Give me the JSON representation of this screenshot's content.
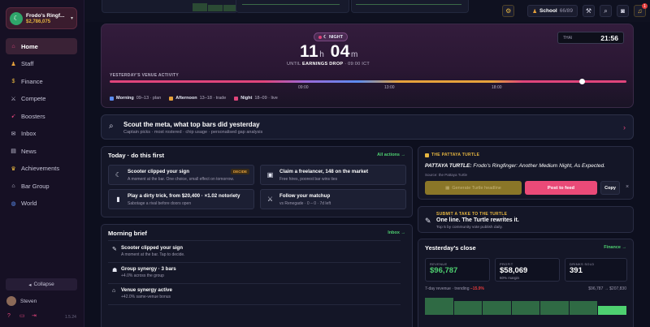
{
  "brand": {
    "name": "Frodo's Ringf...",
    "money": "$2,786,075",
    "avatar_glyph": "☾"
  },
  "nav": [
    {
      "label": "Home",
      "icon": "home-icon",
      "glyph": "⌂",
      "color": "#e0457b",
      "active": true
    },
    {
      "label": "Staff",
      "icon": "staff-icon",
      "glyph": "♟",
      "color": "#e6a23c"
    },
    {
      "label": "Finance",
      "icon": "finance-icon",
      "glyph": "$",
      "color": "#e6b640"
    },
    {
      "label": "Compete",
      "icon": "swords-icon",
      "glyph": "⚔",
      "color": "#c5c3d6"
    },
    {
      "label": "Boosters",
      "icon": "rocket-icon",
      "glyph": "➹",
      "color": "#e0457b"
    },
    {
      "label": "Inbox",
      "icon": "inbox-icon",
      "glyph": "✉",
      "color": "#c5c3d6"
    },
    {
      "label": "News",
      "icon": "news-icon",
      "glyph": "▤",
      "color": "#c5c3d6"
    },
    {
      "label": "Achievements",
      "icon": "trophy-icon",
      "glyph": "♛",
      "color": "#e6b640"
    },
    {
      "label": "Bar Group",
      "icon": "group-icon",
      "glyph": "⌂",
      "color": "#c5c3d6"
    },
    {
      "label": "World",
      "icon": "globe-icon",
      "glyph": "◍",
      "color": "#5b8cf0"
    }
  ],
  "collapse_label": "Collapse",
  "user_name": "Steven",
  "version": "1.5.24",
  "topbar": {
    "school_label": "School",
    "school_count": "66/89",
    "notif_count": "1"
  },
  "hero": {
    "pill": "NIGHT",
    "hours": "11",
    "hours_unit": "h",
    "minutes": "04",
    "minutes_unit": "m",
    "until_prefix": "UNTIL",
    "until_event": "EARNINGS DROP",
    "until_time": "· 09:00 ICT",
    "clock_tz": "THAI",
    "clock_time": "21:56",
    "activity_label": "YESTERDAY'S VENUE ACTIVITY",
    "ticks": [
      "09:00",
      "13:00",
      "18:00"
    ],
    "current_position": 0.915,
    "legend": [
      {
        "name": "Morning",
        "range": "09–13 · plan",
        "color": "#5b8cf0"
      },
      {
        "name": "Afternoon",
        "range": "13–18 · trade",
        "color": "#e6a23c"
      },
      {
        "name": "Night",
        "range": "18–09 · live",
        "color": "#e0457b"
      }
    ]
  },
  "scout": {
    "title": "Scout the meta, what top bars did yesterday",
    "subtitle": "Captain picks · most rostered · chip usage · personalised gap analysis"
  },
  "today": {
    "title": "Today · do this first",
    "link": "All actions →",
    "cards": [
      {
        "title": "Scooter clipped your sign",
        "desc": "A moment at the bar. One choice, small effect on tomorrow.",
        "icon": "moon-icon",
        "glyph": "☾",
        "tag": "DECIDE"
      },
      {
        "title": "Claim a freelancer, 148 on the market",
        "desc": "Free hires, poorest bar wins ties",
        "icon": "card-icon",
        "glyph": "▣"
      },
      {
        "title": "Play a dirty trick, from $20,400 · ×1.02 notoriety",
        "desc": "Sabotage a rival before doors open",
        "icon": "trick-icon",
        "glyph": "▮"
      },
      {
        "title": "Follow your matchup",
        "desc": "vs Renegade · 0 – 0 · 7d left",
        "icon": "swords-icon",
        "glyph": "⚔"
      }
    ]
  },
  "brief": {
    "title": "Morning brief",
    "link": "Inbox →",
    "items": [
      {
        "title": "Scooter clipped your sign",
        "desc": "A moment at the bar. Tap to decide.",
        "icon": "scooter-icon",
        "glyph": "✎"
      },
      {
        "title": "Group synergy · 3 bars",
        "desc": "+4.0% across the group",
        "icon": "group-icon",
        "glyph": "☗"
      },
      {
        "title": "Venue synergy active",
        "desc": "+42.0% same-venue bonus",
        "icon": "venue-icon",
        "glyph": "⌂"
      }
    ]
  },
  "turtle": {
    "tag": "THE PATTAYA TURTLE",
    "headline_bold": "PATTAYA TURTLE:",
    "headline_rest": "Frodo's Ringfinger: Another Medium Night, As Expected.",
    "source": "Source: the Pattaya Turtle",
    "generate_label": "Generate Turtle headline",
    "post_label": "Post to feed",
    "copy_label": "Copy",
    "close_glyph": "×"
  },
  "submit": {
    "tag": "SUBMIT A TAKE TO THE TURTLE",
    "title": "One line. The Turtle rewrites it.",
    "subtitle": "Top 5 by community vote publish daily."
  },
  "close": {
    "title": "Yesterday's close",
    "link": "Finance →",
    "stats": [
      {
        "label": "REVENUE",
        "value": "$96,787",
        "sub": "",
        "color": "#4ed070"
      },
      {
        "label": "PROFIT",
        "value": "$58,069",
        "sub": "60% margin",
        "color": "#ffffff"
      },
      {
        "label": "DRINKS SOLD",
        "value": "391",
        "sub": "",
        "color": "#ffffff"
      }
    ],
    "trend_label": "7-day revenue · trending",
    "trend_value": "−15.9%",
    "trend_range": "$96,787 → $207,830",
    "bars": [
      0.92,
      0.72,
      0.72,
      0.72,
      0.72,
      0.72,
      0.46
    ]
  },
  "colors": {
    "accent": "#e0457b",
    "positive": "#4ed070",
    "gold": "#e6b640"
  }
}
